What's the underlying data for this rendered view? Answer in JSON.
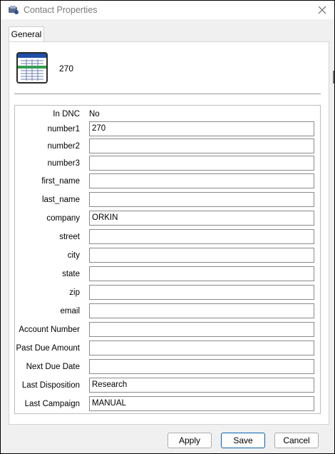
{
  "window": {
    "title": "Contact Properties",
    "icons": {
      "app": "contact-app-icon",
      "close": "close-icon"
    }
  },
  "tabs": [
    {
      "label": "General",
      "active": true
    }
  ],
  "contact": {
    "display_name": "270",
    "icon": "spreadsheet-card-icon"
  },
  "fields": {
    "in_dnc": {
      "label": "In DNC",
      "value": "No"
    },
    "items": [
      {
        "label": "number1",
        "value": "270"
      },
      {
        "label": "number2",
        "value": ""
      },
      {
        "label": "number3",
        "value": ""
      },
      {
        "label": "first_name",
        "value": ""
      },
      {
        "label": "last_name",
        "value": ""
      },
      {
        "label": "company",
        "value": "ORKIN"
      },
      {
        "label": "street",
        "value": ""
      },
      {
        "label": "city",
        "value": ""
      },
      {
        "label": "state",
        "value": ""
      },
      {
        "label": "zip",
        "value": ""
      },
      {
        "label": "email",
        "value": ""
      },
      {
        "label": "Account Number",
        "value": ""
      },
      {
        "label": "Past Due Amount",
        "value": ""
      },
      {
        "label": "Next Due Date",
        "value": ""
      },
      {
        "label": "Last Disposition",
        "value": "Research"
      },
      {
        "label": "Last Campaign",
        "value": "MANUAL"
      }
    ]
  },
  "buttons": {
    "apply": "Apply",
    "save": "Save",
    "cancel": "Cancel"
  },
  "colors": {
    "accent_border": "#0a64ad",
    "icon_blue": "#1e4fa8",
    "icon_green": "#2fa24a"
  }
}
